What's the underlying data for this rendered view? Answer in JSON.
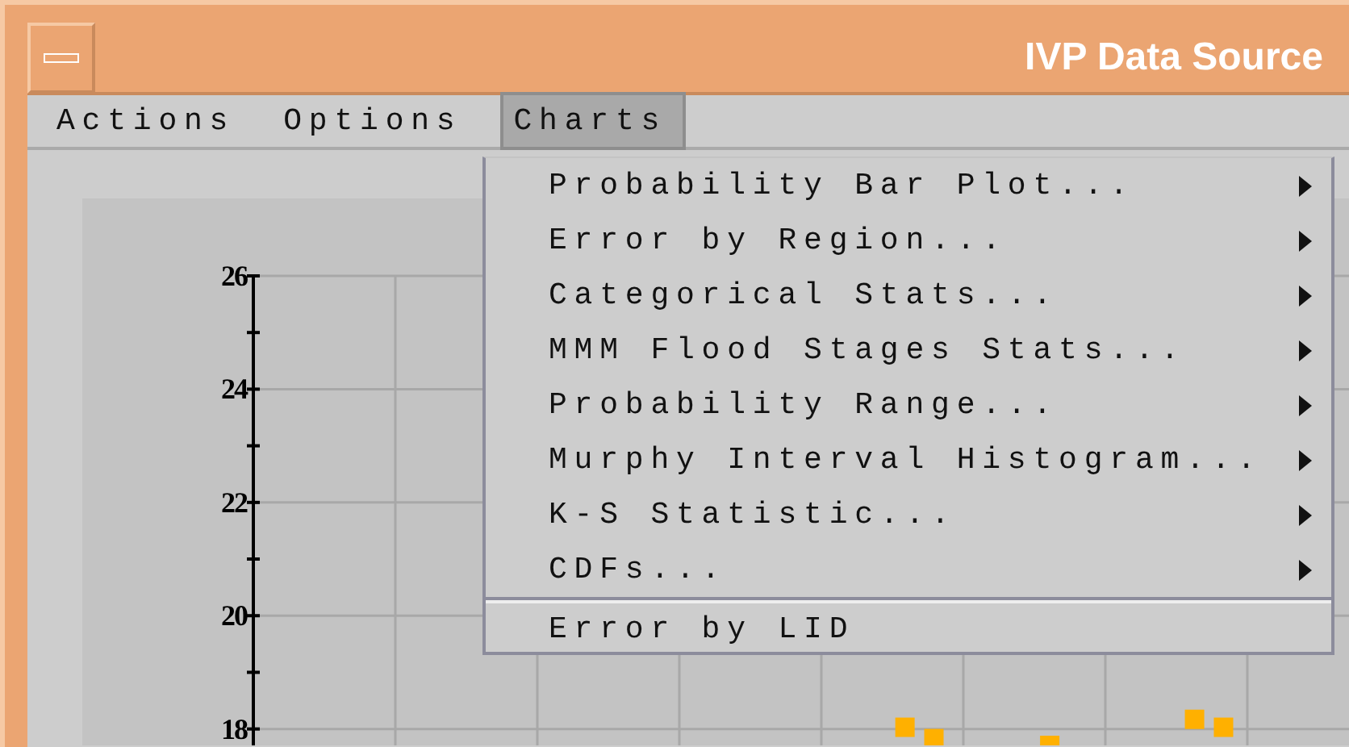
{
  "window": {
    "title": "IVP Data Source"
  },
  "menubar": [
    {
      "label": "Actions",
      "selected": false
    },
    {
      "label": "Options",
      "selected": false
    },
    {
      "label": "Charts",
      "selected": true
    }
  ],
  "charts_menu": {
    "groups": [
      [
        {
          "label": "Probability Bar Plot...",
          "has_submenu": true,
          "selected": false
        },
        {
          "label": "Error by Region...",
          "has_submenu": true,
          "selected": false
        },
        {
          "label": "Categorical Stats...",
          "has_submenu": true,
          "selected": false
        },
        {
          "label": "MMM Flood Stages Stats...",
          "has_submenu": true,
          "selected": false
        },
        {
          "label": "Probability Range...",
          "has_submenu": true,
          "selected": false
        },
        {
          "label": "Murphy Interval Histogram...",
          "has_submenu": true,
          "selected": false
        },
        {
          "label": "K-S Statistic...",
          "has_submenu": true,
          "selected": false
        },
        {
          "label": "CDFs...",
          "has_submenu": true,
          "selected": false
        }
      ],
      [
        {
          "label": "Error by LID",
          "has_submenu": false,
          "selected": false
        }
      ]
    ]
  },
  "chart": {
    "chart_data": {
      "type": "scatter",
      "grid": true,
      "categories": [
        null,
        null,
        null,
        null,
        null,
        null,
        null,
        null,
        null,
        null,
        null,
        null,
        null,
        null,
        null,
        null,
        null,
        null,
        null,
        null,
        null,
        null,
        null,
        null,
        null,
        null,
        null,
        null,
        null,
        null,
        null,
        null,
        null,
        null,
        null,
        null,
        null,
        null
      ],
      "ylim": [
        17.71,
        26
      ],
      "yticks": [
        18,
        20,
        22,
        24,
        26
      ],
      "series": [
        {
          "color": "#ffb000",
          "values": [
            null,
            null,
            null,
            null,
            null,
            null,
            null,
            null,
            null,
            null,
            null,
            null,
            null,
            null,
            null,
            null,
            null,
            null,
            null,
            null,
            null,
            null,
            18.03,
            17.83,
            null,
            null,
            null,
            17.71,
            null,
            null,
            null,
            null,
            18.17,
            18.03,
            null,
            null,
            null,
            null
          ]
        }
      ]
    }
  }
}
